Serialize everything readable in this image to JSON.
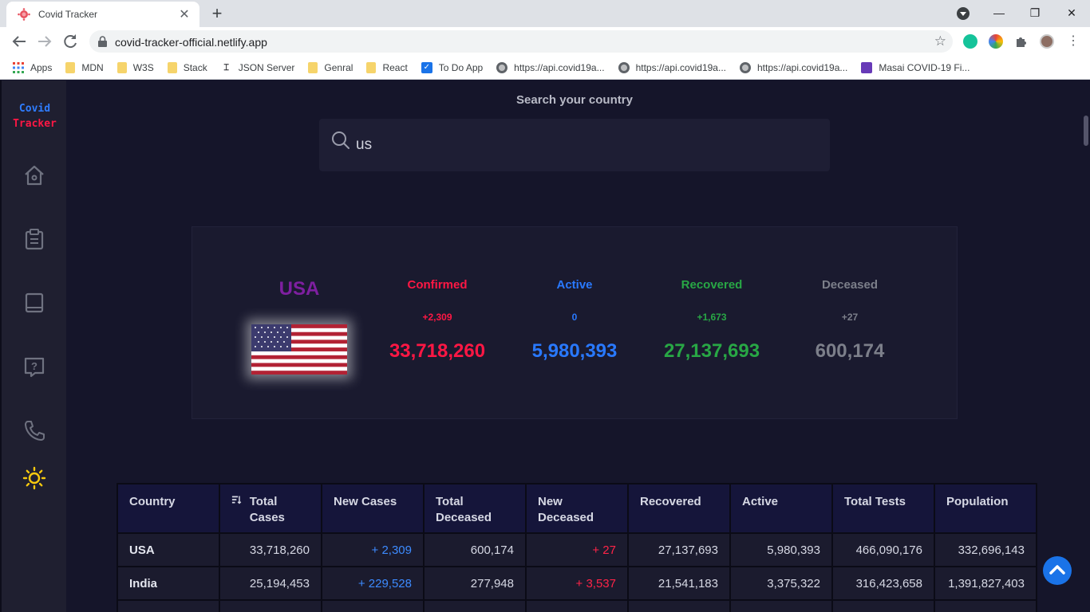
{
  "browser": {
    "tab_title": "Covid Tracker",
    "url": "covid-tracker-official.netlify.app",
    "bookmarks": [
      {
        "label": "Apps",
        "icon": "apps-grid-icon"
      },
      {
        "label": "MDN",
        "icon": "folder-icon"
      },
      {
        "label": "W3S",
        "icon": "folder-icon"
      },
      {
        "label": "Stack",
        "icon": "folder-icon"
      },
      {
        "label": "JSON Server",
        "icon": "json-server-icon"
      },
      {
        "label": "Genral",
        "icon": "folder-icon"
      },
      {
        "label": "React",
        "icon": "folder-icon"
      },
      {
        "label": "To Do App",
        "icon": "checkbox-icon"
      },
      {
        "label": "https://api.covid19a...",
        "icon": "globe-icon"
      },
      {
        "label": "https://api.covid19a...",
        "icon": "globe-icon"
      },
      {
        "label": "https://api.covid19a...",
        "icon": "globe-icon"
      },
      {
        "label": "Masai COVID-19 Fi...",
        "icon": "form-icon"
      }
    ]
  },
  "app": {
    "logo_line1": "Covid",
    "logo_line2": "Tracker",
    "sidebar_icons": [
      "home-icon",
      "clipboard-icon",
      "book-icon",
      "help-icon",
      "phone-icon",
      "sun-icon"
    ],
    "search": {
      "label": "Search your country",
      "value": "us"
    },
    "country": {
      "name": "USA",
      "stats": [
        {
          "label": "Confirmed",
          "delta": "+2,309",
          "total": "33,718,260",
          "color": "#ff1744"
        },
        {
          "label": "Active",
          "delta": "0",
          "total": "5,980,393",
          "color": "#2979ff"
        },
        {
          "label": "Recovered",
          "delta": "+1,673",
          "total": "27,137,693",
          "color": "#28a745"
        },
        {
          "label": "Deceased",
          "delta": "+27",
          "total": "600,174",
          "color": "#7c7f8a"
        }
      ]
    },
    "table": {
      "headers": [
        "Country",
        "Total Cases",
        "New Cases",
        "Total Deceased",
        "New Deceased",
        "Recovered",
        "Active",
        "Total Tests",
        "Population"
      ],
      "rows": [
        [
          "USA",
          "33,718,260",
          "+ 2,309",
          "600,174",
          "+ 27",
          "27,137,693",
          "5,980,393",
          "466,090,176",
          "332,696,143"
        ],
        [
          "India",
          "25,194,453",
          "+ 229,528",
          "277,948",
          "+ 3,537",
          "21,541,183",
          "3,375,322",
          "316,423,658",
          "1,391,827,403"
        ]
      ]
    }
  }
}
